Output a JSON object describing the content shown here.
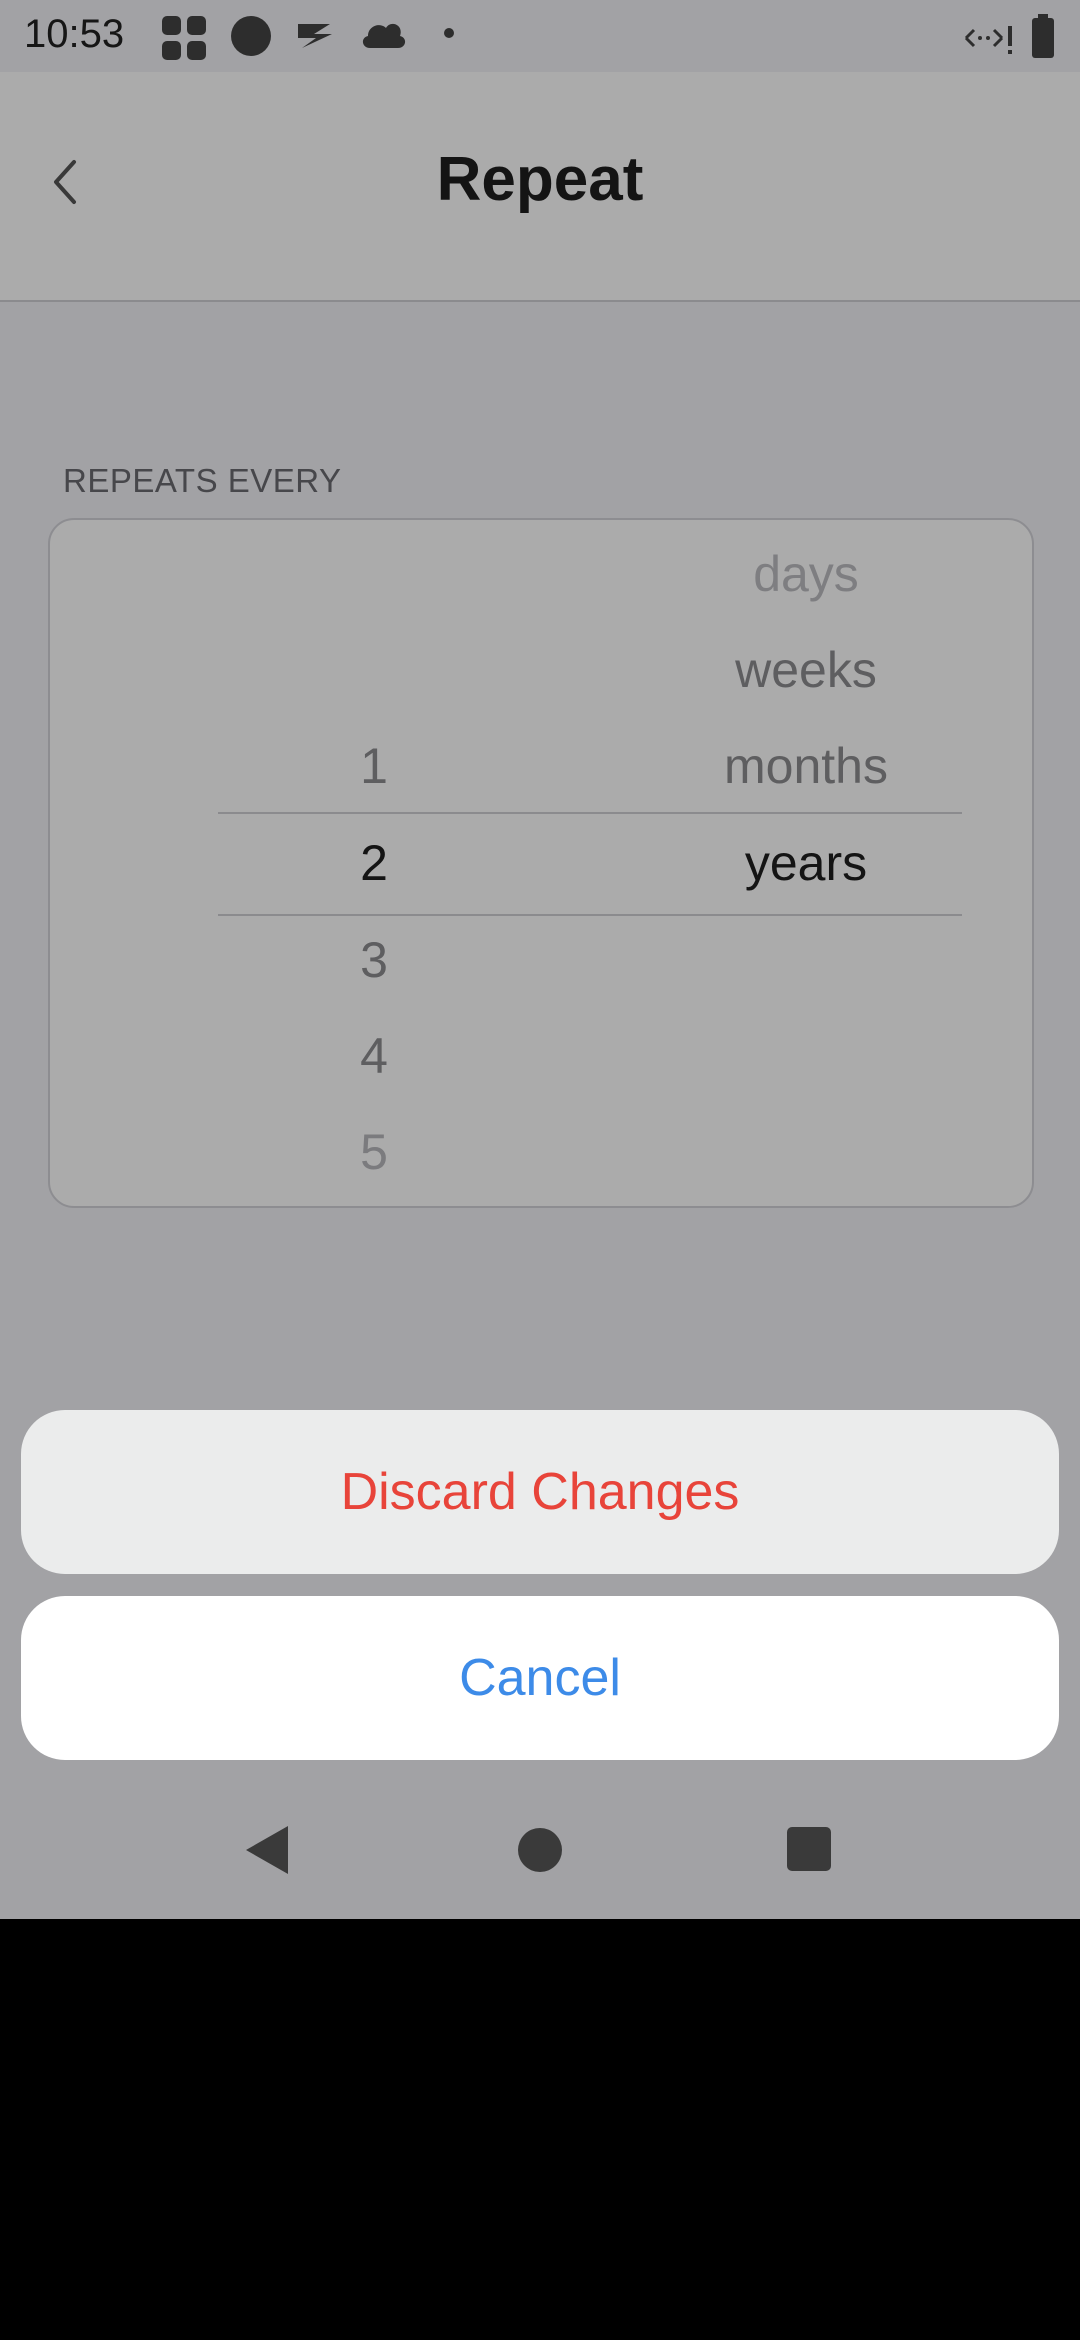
{
  "status_bar": {
    "time": "10:53",
    "icons": [
      "app-grid-icon",
      "circle-icon",
      "signal-arrow-icon",
      "cloud-icon",
      "dot-icon",
      "data-transfer-icon",
      "battery-icon"
    ]
  },
  "header": {
    "title": "Repeat",
    "back_icon": "chevron-left-icon"
  },
  "repeat": {
    "section_label": "REPEATS EVERY",
    "numbers": [
      {
        "label": "1",
        "state": "near"
      },
      {
        "label": "2",
        "state": "selected"
      },
      {
        "label": "3",
        "state": "near"
      },
      {
        "label": "4",
        "state": "near"
      },
      {
        "label": "5",
        "state": "far"
      }
    ],
    "units": [
      {
        "label": "days",
        "state": "far"
      },
      {
        "label": "weeks",
        "state": "near"
      },
      {
        "label": "months",
        "state": "near"
      },
      {
        "label": "years",
        "state": "selected"
      }
    ],
    "selected_number": "2",
    "selected_unit": "years"
  },
  "action_sheet": {
    "discard_label": "Discard Changes",
    "cancel_label": "Cancel"
  },
  "system_nav": {
    "icons": [
      "back-triangle-icon",
      "home-circle-icon",
      "recents-square-icon"
    ]
  },
  "colors": {
    "discard": "#e8443a",
    "cancel": "#3d8be8",
    "background": "#f2f2f6"
  }
}
